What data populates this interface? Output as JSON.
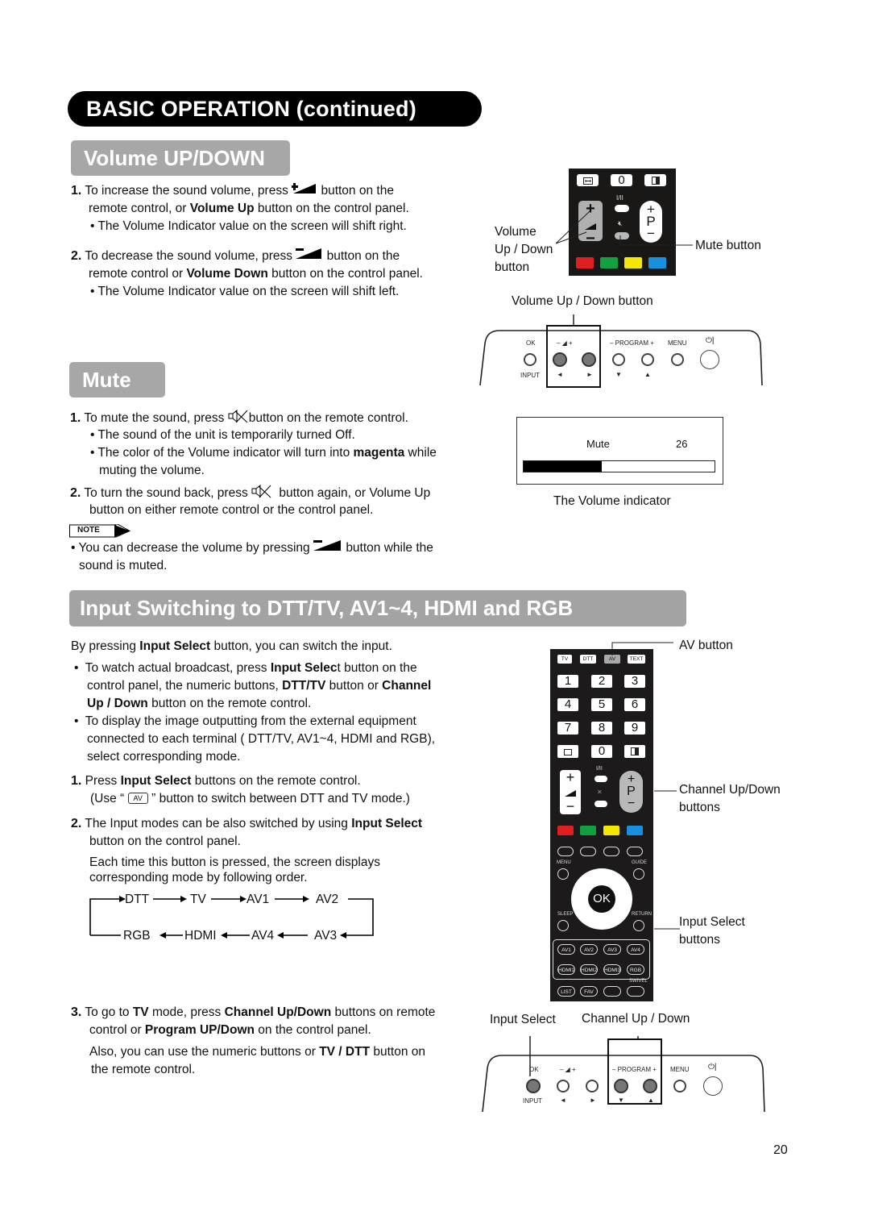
{
  "page_header": "BASIC OPERATION (continued)",
  "volume": {
    "title": "Volume UP/DOWN",
    "step1": {
      "num": "1.",
      "l1a": "To increase the sound volume, press",
      "l1b": "button on the",
      "l2a": "remote control, or ",
      "l2b": "Volume Up",
      "l2c": " button on the control panel.",
      "bullet": "• The Volume Indicator value on the screen will shift right."
    },
    "step2": {
      "num": "2.",
      "l1a": "To decrease the sound volume, press",
      "l1b": "button on the",
      "l2a": "remote control or ",
      "l2b": "Volume Down",
      "l2c": " button on the control panel.",
      "bullet": "• The Volume Indicator value on the screen will shift left."
    },
    "remote_labels": {
      "vol_label_1": "Volume",
      "vol_label_2": "Up / Down",
      "vol_label_3": "button",
      "mute_label": "Mute button",
      "zero": "0",
      "dual": "I/II",
      "p": "P"
    },
    "panel_caption": "Volume Up / Down button"
  },
  "control_panel": {
    "ok": "OK",
    "input": "INPUT",
    "vol": "–  ◢  +",
    "program": "– PROGRAM +",
    "menu": "MENU",
    "power": "⏻|",
    "left": "◄",
    "right": "►",
    "down": "▼",
    "up": "▲"
  },
  "mute": {
    "title": "Mute",
    "step1": {
      "num": "1.",
      "l1a": "To mute the sound, press",
      "l1b": "button on the remote control.",
      "b1": "• The sound of the unit is temporarily turned Off.",
      "b2a": "• The color of the Volume indicator will turn into ",
      "b2b": "magenta",
      "b2c": " while",
      "b2d": "muting the volume."
    },
    "step2": {
      "num": "2.",
      "l1a": "To turn the sound back, press",
      "l1b": "button again, or Volume Up",
      "l2": "button on either remote control or the control panel."
    },
    "note_label": "NOTE",
    "note_l1a": "• You can decrease the volume by pressing",
    "note_l1b": "button while the",
    "note_l2": "sound is muted.",
    "indicator": {
      "label": "Mute",
      "value": "26",
      "level_fraction": 0.41,
      "caption": "The Volume indicator"
    }
  },
  "input": {
    "title": "Input Switching to DTT/TV, AV1~4, HDMI and RGB",
    "intro_a": "By pressing ",
    "intro_b": "Input Select",
    "intro_c": " button, you can switch the input.",
    "bul1_l1a": "To watch actual broadcast, press ",
    "bul1_l1b": "Input Selec",
    "bul1_l1c": "t button on the",
    "bul1_l2a": "control panel, the numeric buttons, ",
    "bul1_l2b": "DTT/TV",
    "bul1_l2c": " button or ",
    "bul1_l2d": "Channel",
    "bul1_l3a": "Up / Down",
    "bul1_l3b": " button on the remote control.",
    "bul2_l1": "To display the image outputting from the external equipment",
    "bul2_l2": "connected to each terminal ( DTT/TV, AV1~4, HDMI and RGB),",
    "bul2_l3": "select corresponding mode.",
    "step1_num": "1.",
    "step1_a": "Press ",
    "step1_b": "Input Select",
    "step1_c": " buttons on the remote control.",
    "step1_l2a": "(Use “",
    "step1_av": "AV",
    "step1_l2b": "” button to switch between DTT and TV mode.)",
    "step2_num": "2.",
    "step2_a": "The Input modes can be also switched by using ",
    "step2_b": "Input Select",
    "step2_l2": "button on the control panel.",
    "step2_l3": "Each time this button is pressed, the screen displays",
    "step2_l4": "corresponding mode by following order.",
    "cycle_top": [
      "DTT",
      "TV",
      "AV1",
      "AV2"
    ],
    "cycle_bottom": [
      "RGB",
      "HDMI",
      "AV4",
      "AV3"
    ],
    "step3_num": "3.",
    "step3_a": "To go to ",
    "step3_b": "TV",
    "step3_c": " mode, press ",
    "step3_d": "Channel Up/Down",
    "step3_e": " buttons on remote",
    "step3_l2a": "control or ",
    "step3_l2b": "Program UP/Down",
    "step3_l2c": " on the control panel.",
    "step3_l3a": "Also, you can use the numeric buttons or ",
    "step3_l3b": "TV / DTT",
    "step3_l3c": " button on",
    "step3_l4": "the remote control.",
    "remote_labels": {
      "av_button": "AV button",
      "ch_1": "Channel Up/Down",
      "ch_2": "buttons",
      "is_1": "Input Select",
      "is_2": "buttons"
    },
    "remote_keys": {
      "top": [
        "TV",
        "DTT",
        "AV",
        "TEXT"
      ],
      "digits": [
        "1",
        "2",
        "3",
        "4",
        "5",
        "6",
        "7",
        "8",
        "9"
      ],
      "zero": "0",
      "dual": "I/II",
      "p": "P",
      "menu": "MENU",
      "guide": "GUIDE",
      "ok": "OK",
      "sleep": "SLEEP",
      "return": "RETURN",
      "inputs_row1": [
        "AV1",
        "AV2",
        "AV3",
        "AV4"
      ],
      "inputs_row2": [
        "HDMI1",
        "HDMI2",
        "HDMI3",
        "RGB"
      ],
      "swivel": "SWIVEL",
      "bottom": [
        "LIST",
        "FAV"
      ]
    },
    "panel_label_input": "Input Select",
    "panel_label_channel": "Channel Up / Down"
  },
  "colors": {
    "red": "#e02020",
    "green": "#12a040",
    "yellow": "#f5e800",
    "blue": "#1890e0",
    "header_gray": "#a7a7a7"
  },
  "page_number": "20"
}
